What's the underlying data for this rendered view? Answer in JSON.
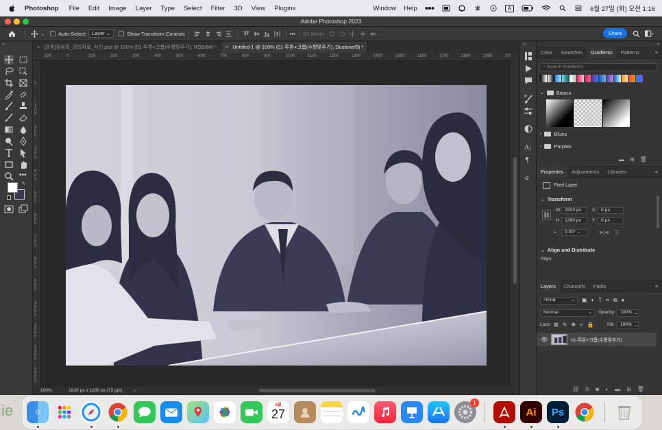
{
  "menubar": {
    "app_name": "Photoshop",
    "items": [
      "File",
      "Edit",
      "Image",
      "Layer",
      "Type",
      "Select",
      "Filter",
      "3D",
      "View",
      "Plugins"
    ],
    "right_items": [
      "Window",
      "Help"
    ],
    "input_badge": "A",
    "datetime": "6월 27일 (화) 오전 1:16"
  },
  "window": {
    "title": "Adobe Photoshop 2023"
  },
  "options": {
    "auto_select_label": "Auto-Select:",
    "auto_select_value": "Layer",
    "transform_label": "Show Transform Controls",
    "mode_3d": "3D Mode:",
    "share_label": "Share"
  },
  "tabs": [
    {
      "label": "[최종]김용희_강의자료_사진.psd @ 100% (01-투톤+크롭(수평맞추기), RGB/8#) *",
      "active": false
    },
    {
      "label": "Untitled-1 @ 100% (01-투톤+크롭(수평맞추기), Duotone/8) *",
      "active": true
    }
  ],
  "ruler": {
    "h_labels": [
      "100",
      "0",
      "100",
      "200",
      "300",
      "400",
      "500",
      "600",
      "700",
      "800",
      "900",
      "1000",
      "1100",
      "1200",
      "1300",
      "1400",
      "1500",
      "1600",
      "1700",
      "1800",
      "1900",
      "200"
    ],
    "v_labels": [
      "0",
      "100",
      "200",
      "300",
      "400",
      "500",
      "600",
      "700",
      "800",
      "900",
      "1000",
      "1100",
      "1200",
      "1300"
    ]
  },
  "status": {
    "zoom": "100%",
    "doc_info": "1920 px x 1280 px (72 ppi)",
    "arrow": "›"
  },
  "gradients_panel": {
    "tabs": [
      "Color",
      "Swatches",
      "Gradients",
      "Patterns"
    ],
    "active_tab": "Gradients",
    "search_placeholder": "Search Gradients",
    "folders": [
      {
        "name": "Basics",
        "expanded": true
      },
      {
        "name": "Blues",
        "expanded": false
      },
      {
        "name": "Purples",
        "expanded": false
      }
    ]
  },
  "properties_panel": {
    "tabs": [
      "Properties",
      "Adjustments",
      "Libraries"
    ],
    "active_tab": "Properties",
    "layer_type": "Pixel Layer",
    "transform_title": "Transform",
    "w_label": "W",
    "w_value": "1920 px",
    "h_label": "H",
    "h_value": "1280 px",
    "x_label": "X",
    "x_value": "0 px",
    "y_label": "Y",
    "y_value": "0 px",
    "angle_value": "0.00°",
    "align_title": "Align and Distribute",
    "align_label": "Align:"
  },
  "layers_panel": {
    "tabs": [
      "Layers",
      "Channels",
      "Paths"
    ],
    "active_tab": "Layers",
    "kind_label": "Kind",
    "blend_mode": "Normal",
    "opacity_label": "Opacity:",
    "opacity_value": "100%",
    "lock_label": "Lock:",
    "fill_label": "Fill:",
    "fill_value": "100%",
    "layers": [
      {
        "name": "01-투톤+크롭(수평맞추기)",
        "visible": true
      }
    ]
  },
  "dock": {
    "calendar_month": "6월",
    "calendar_day": "27",
    "settings_badge": "1",
    "apps": [
      "finder",
      "launchpad",
      "safari",
      "chrome",
      "messages",
      "mail",
      "maps",
      "photos",
      "facetime",
      "calendar",
      "contacts",
      "notes",
      "freeform",
      "music",
      "keynote",
      "app-store",
      "system-settings",
      "acrobat",
      "illustrator",
      "photoshop",
      "chrome-2",
      "trash"
    ],
    "illustrator_label": "Ai",
    "photoshop_label": "Ps",
    "bg_text": "ie"
  },
  "colors": {
    "accent": "#1473e6",
    "duotone_dark": "#3a3b52",
    "duotone_light": "#e6e6ee"
  }
}
